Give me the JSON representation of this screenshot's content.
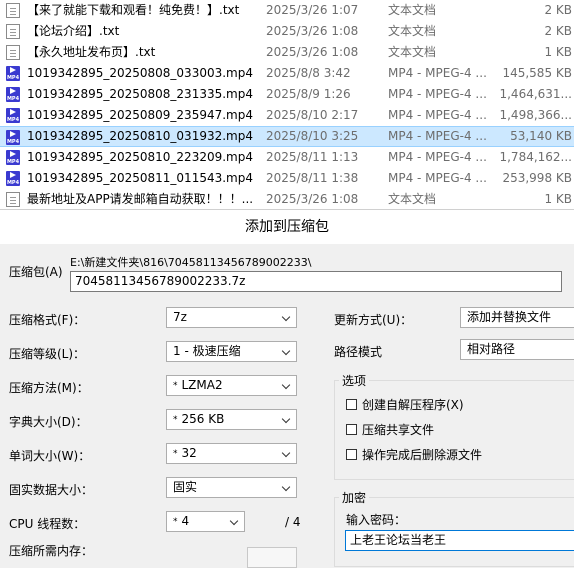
{
  "files": [
    {
      "name": "【来了就能下载和观看！纯免费！】.txt",
      "date": "2025/3/26 1:07",
      "type": "文本文档",
      "size": "2 KB",
      "icon": "text-file-icon",
      "selected": false
    },
    {
      "name": "【论坛介绍】.txt",
      "date": "2025/3/26 1:08",
      "type": "文本文档",
      "size": "2 KB",
      "icon": "text-file-icon",
      "selected": false
    },
    {
      "name": "【永久地址发布页】.txt",
      "date": "2025/3/26 1:08",
      "type": "文本文档",
      "size": "1 KB",
      "icon": "text-file-icon",
      "selected": false
    },
    {
      "name": "1019342895_20250808_033003.mp4",
      "date": "2025/8/8 3:42",
      "type": "MP4 - MPEG-4 ...",
      "size": "145,585 KB",
      "icon": "mp4-file-icon",
      "selected": false
    },
    {
      "name": "1019342895_20250808_231335.mp4",
      "date": "2025/8/9 1:26",
      "type": "MP4 - MPEG-4 ...",
      "size": "1,464,631...",
      "icon": "mp4-file-icon",
      "selected": false
    },
    {
      "name": "1019342895_20250809_235947.mp4",
      "date": "2025/8/10 2:17",
      "type": "MP4 - MPEG-4 ...",
      "size": "1,498,366...",
      "icon": "mp4-file-icon",
      "selected": false
    },
    {
      "name": "1019342895_20250810_031932.mp4",
      "date": "2025/8/10 3:25",
      "type": "MP4 - MPEG-4 ...",
      "size": "53,140 KB",
      "icon": "mp4-file-icon",
      "selected": true
    },
    {
      "name": "1019342895_20250810_223209.mp4",
      "date": "2025/8/11 1:13",
      "type": "MP4 - MPEG-4 ...",
      "size": "1,784,162...",
      "icon": "mp4-file-icon",
      "selected": false
    },
    {
      "name": "1019342895_20250811_011543.mp4",
      "date": "2025/8/11 1:38",
      "type": "MP4 - MPEG-4 ...",
      "size": "253,998 KB",
      "icon": "mp4-file-icon",
      "selected": false
    },
    {
      "name": "最新地址及APP请发邮箱自动获取！！！...",
      "date": "2025/3/26 1:08",
      "type": "文本文档",
      "size": "1 KB",
      "icon": "text-file-icon",
      "selected": false
    }
  ],
  "mp4_icon_text": "MP4",
  "dialog": {
    "title": "添加到压缩包",
    "archive_label": "压缩包(A)",
    "archive_path": "E:\\新建文件夹\\816\\70458113456789002233\\",
    "archive_name": "70458113456789002233.7z",
    "format_label": "压缩格式(F)：",
    "format_value": "7z",
    "level_label": "压缩等级(L)：",
    "level_value": "1 - 极速压缩",
    "method_label": "压缩方法(M)：",
    "method_value": "LZMA2",
    "dict_label": "字典大小(D)：",
    "dict_value": "256 KB",
    "word_label": "单词大小(W)：",
    "word_value": "32",
    "solid_label": "固实数据大小：",
    "solid_value": "固实",
    "cpu_label": "CPU 线程数：",
    "cpu_value": "4",
    "cpu_total": "/ 4",
    "mem_label": "压缩所需内存：",
    "star": "*",
    "update_label": "更新方式(U)：",
    "update_value": "添加并替换文件",
    "pathmode_label": "路径模式",
    "pathmode_value": "相对路径",
    "options_title": "选项",
    "opt_sfx": "创建自解压程序(X)",
    "opt_shared": "压缩共享文件",
    "opt_delete": "操作完成后删除源文件",
    "encrypt_title": "加密",
    "password_label": "输入密码：",
    "password_value": "上老王论坛当老王"
  }
}
